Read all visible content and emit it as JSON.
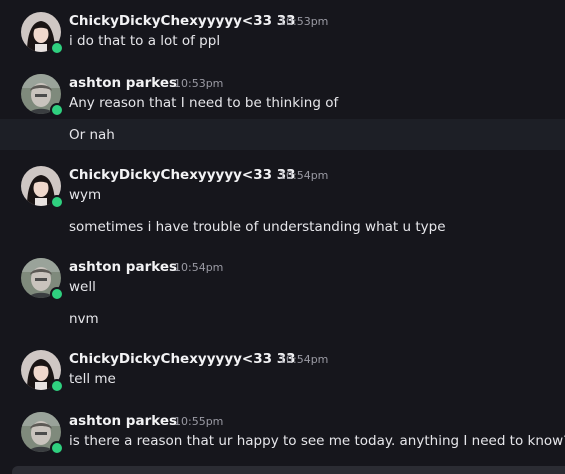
{
  "messages": [
    {
      "username": "ChickyDickyChexyyyyy<33 33",
      "time": "10:53pm",
      "text": "i do that to a lot of ppl"
    },
    {
      "username": "ashton parkes",
      "time": "10:53pm",
      "text": "Any reason that I need to be thinking of"
    },
    {
      "text": "Or nah"
    },
    {
      "username": "ChickyDickyChexyyyyy<33 33",
      "time": "10:54pm",
      "text": "wym"
    },
    {
      "text": "sometimes i have trouble of understanding what u type"
    },
    {
      "username": "ashton parkes",
      "time": "10:54pm",
      "text": "well"
    },
    {
      "text": "nvm"
    },
    {
      "username": "ChickyDickyChexyyyyy<33 33",
      "time": "10:54pm",
      "text": "tell me"
    },
    {
      "username": "ashton parkes",
      "time": "10:55pm",
      "text": "is there a reason that ur happy to see me today. anything I need to know?"
    }
  ],
  "colors": {
    "background": "#16161c",
    "highlight_row": "#1d1f26",
    "online_status": "#2fd07f"
  },
  "icons": {
    "status": "online-status-icon"
  }
}
